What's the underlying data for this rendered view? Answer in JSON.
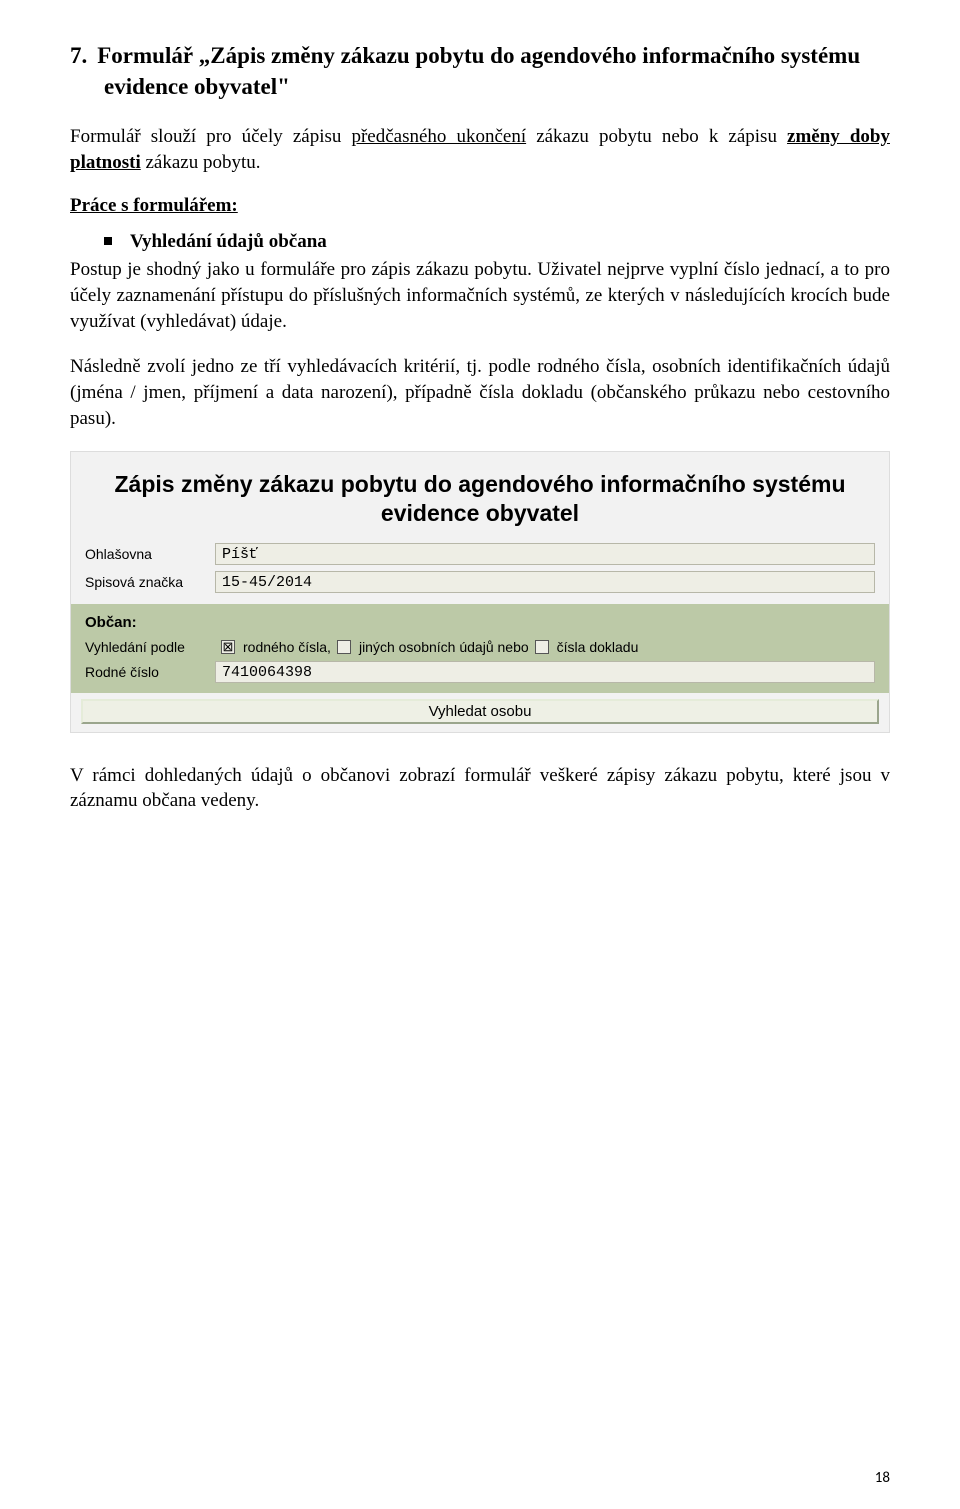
{
  "heading": {
    "number": "7.",
    "text": "Formulář „Zápis změny zákazu pobytu do agendového  informačního systému evidence obyvatel\""
  },
  "para1_pre": "Formulář slouží pro účely zápisu ",
  "para1_u1": "předčasného ukončení",
  "para1_mid": " zákazu pobytu nebo k zápisu ",
  "para1_u2b": "změny doby platnosti",
  "para1_post": " zákazu pobytu.",
  "subhead": "Práce s formulářem:",
  "bullet1": "Vyhledání údajů občana",
  "para2": "Postup je shodný jako u formuláře pro zápis zákazu pobytu. Uživatel nejprve vyplní číslo jednací, a to pro účely zaznamenání přístupu do příslušných informačních systémů, ze kterých v následujících krocích bude využívat (vyhledávat) údaje.",
  "para3": "Následně zvolí jedno ze tří vyhledávacích kritérií, tj. podle rodného čísla, osobních identifikačních údajů (jména / jmen, příjmení a data narození), případně čísla dokladu (občanského průkazu nebo cestovního pasu).",
  "form": {
    "title": "Zápis změny zákazu pobytu do agendového informačního systému evidence obyvatel",
    "ohlasovna_label": "Ohlašovna",
    "ohlasovna_value": "Píšť",
    "spis_label": "Spisová značka",
    "spis_value": "15-45/2014",
    "obcan_label": "Občan:",
    "vyhledani_label": "Vyhledání podle",
    "option1": "rodného čísla,",
    "option2": "jiných osobních údajů nebo",
    "option3": "čísla dokladu",
    "rodne_label": "Rodné číslo",
    "rodne_value": "7410064398",
    "search_button": "Vyhledat osobu"
  },
  "para4": "V rámci dohledaných údajů o občanovi zobrazí formulář veškeré zápisy zákazu pobytu, které jsou v záznamu občana vedeny.",
  "page_number": "18"
}
